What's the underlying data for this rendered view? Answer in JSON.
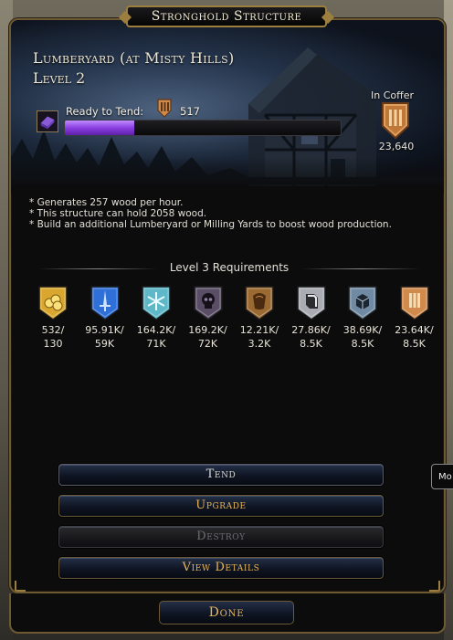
{
  "window": {
    "title": "Stronghold Structure"
  },
  "structure": {
    "name": "Lumberyard (at Misty Hills)",
    "level": "Level 2",
    "ready_label": "Ready to Tend:",
    "ready_value": "517",
    "ready_progress_pct": 25,
    "coffer_label": "In Coffer",
    "coffer_value": "23,640"
  },
  "description": [
    "* Generates 257 wood per hour.",
    "* This structure can hold 2058 wood.",
    "* Build an additional Lumberyard or Milling Yards to boost wood production."
  ],
  "requirements": {
    "heading": "Level 3 Requirements",
    "items": [
      {
        "icon": "gold-coins-icon",
        "line1": "532/",
        "line2": "130",
        "color": "#d9a62e"
      },
      {
        "icon": "blue-sword-icon",
        "line1": "95.91K/",
        "line2": "59K",
        "color": "#2f6fd8"
      },
      {
        "icon": "snowflake-icon",
        "line1": "164.2K/",
        "line2": "71K",
        "color": "#5fb8c8"
      },
      {
        "icon": "skull-icon",
        "line1": "169.2K/",
        "line2": "72K",
        "color": "#5a4e66"
      },
      {
        "icon": "leather-icon",
        "line1": "12.21K/",
        "line2": "3.2K",
        "color": "#9a6a32"
      },
      {
        "icon": "iron-icon",
        "line1": "27.86K/",
        "line2": "8.5K",
        "color": "#a9acb2"
      },
      {
        "icon": "stone-icon",
        "line1": "38.69K/",
        "line2": "8.5K",
        "color": "#6f8aa2"
      },
      {
        "icon": "wood-icon",
        "line1": "23.64K/",
        "line2": "8.5K",
        "color": "#d08a4c"
      }
    ]
  },
  "buttons": {
    "tend": "Tend",
    "upgrade": "Upgrade",
    "destroy": "Destroy",
    "view_details": "View Details",
    "done": "Done"
  },
  "side_tab": {
    "label": "Mo"
  }
}
